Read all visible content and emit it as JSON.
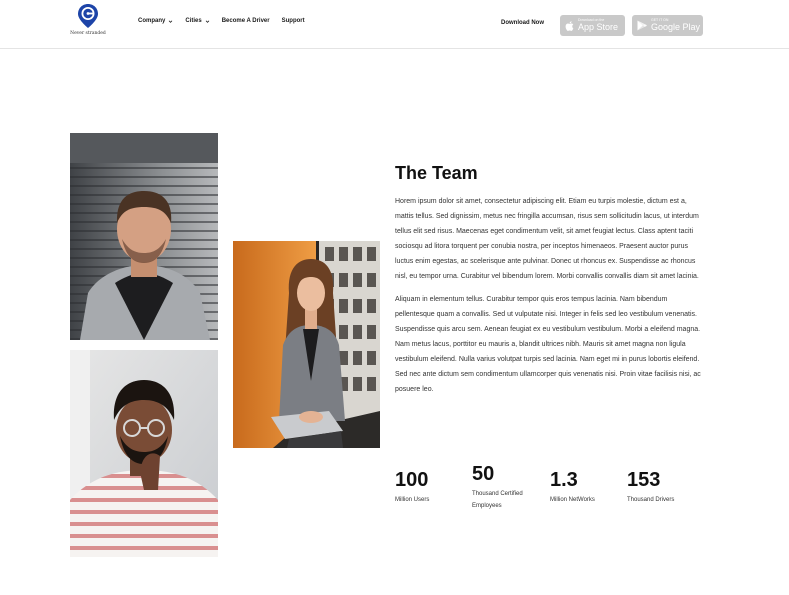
{
  "header": {
    "logo_tagline": "Never stranded",
    "nav": [
      {
        "label": "Company",
        "dropdown": true
      },
      {
        "label": "Cities",
        "dropdown": true
      },
      {
        "label": "Become A Driver",
        "dropdown": false
      },
      {
        "label": "Support",
        "dropdown": false
      }
    ],
    "download_label": "Download Now",
    "app_store": {
      "small": "Download on the",
      "big": "App Store"
    },
    "google_play": {
      "small": "GET IT ON",
      "big": "Google Play"
    }
  },
  "team": {
    "title": "The Team",
    "paragraph_1": "Horem ipsum dolor sit amet, consectetur adipiscing elit. Etiam eu turpis molestie, dictum est a, mattis tellus. Sed dignissim, metus nec fringilla accumsan, risus sem sollicitudin lacus, ut interdum tellus elit sed risus. Maecenas eget condimentum velit, sit amet feugiat lectus. Class aptent taciti sociosqu ad litora torquent per conubia nostra, per inceptos himenaeos. Praesent auctor purus luctus enim egestas, ac scelerisque ante pulvinar. Donec ut rhoncus ex. Suspendisse ac rhoncus nisl, eu tempor urna. Curabitur vel bibendum lorem. Morbi convallis convallis diam sit amet lacinia.",
    "paragraph_2": "Aliquam in elementum tellus. Curabitur tempor quis eros tempus lacinia. Nam bibendum pellentesque quam a convallis. Sed ut vulputate nisi. Integer in felis sed leo vestibulum venenatis. Suspendisse quis arcu sem. Aenean feugiat ex eu vestibulum vestibulum. Morbi a eleifend magna. Nam metus lacus, porttitor eu mauris a, blandit ultrices nibh. Mauris sit amet magna non ligula vestibulum eleifend. Nulla varius volutpat turpis sed lacinia. Nam eget mi in purus lobortis eleifend. Sed nec ante dictum sem condimentum ullamcorper quis venenatis nisi. Proin vitae facilisis nisi, ac posuere leo."
  },
  "stats": [
    {
      "value": "100",
      "label": "Million Users"
    },
    {
      "value": "50",
      "label": "Thousand Certified Employees"
    },
    {
      "value": "1.3",
      "label": "Million NetWorks"
    },
    {
      "value": "153",
      "label": "Thousand Drivers"
    }
  ],
  "colors": {
    "brand": "#1d44a8",
    "store_button": "#c9c9c9"
  }
}
